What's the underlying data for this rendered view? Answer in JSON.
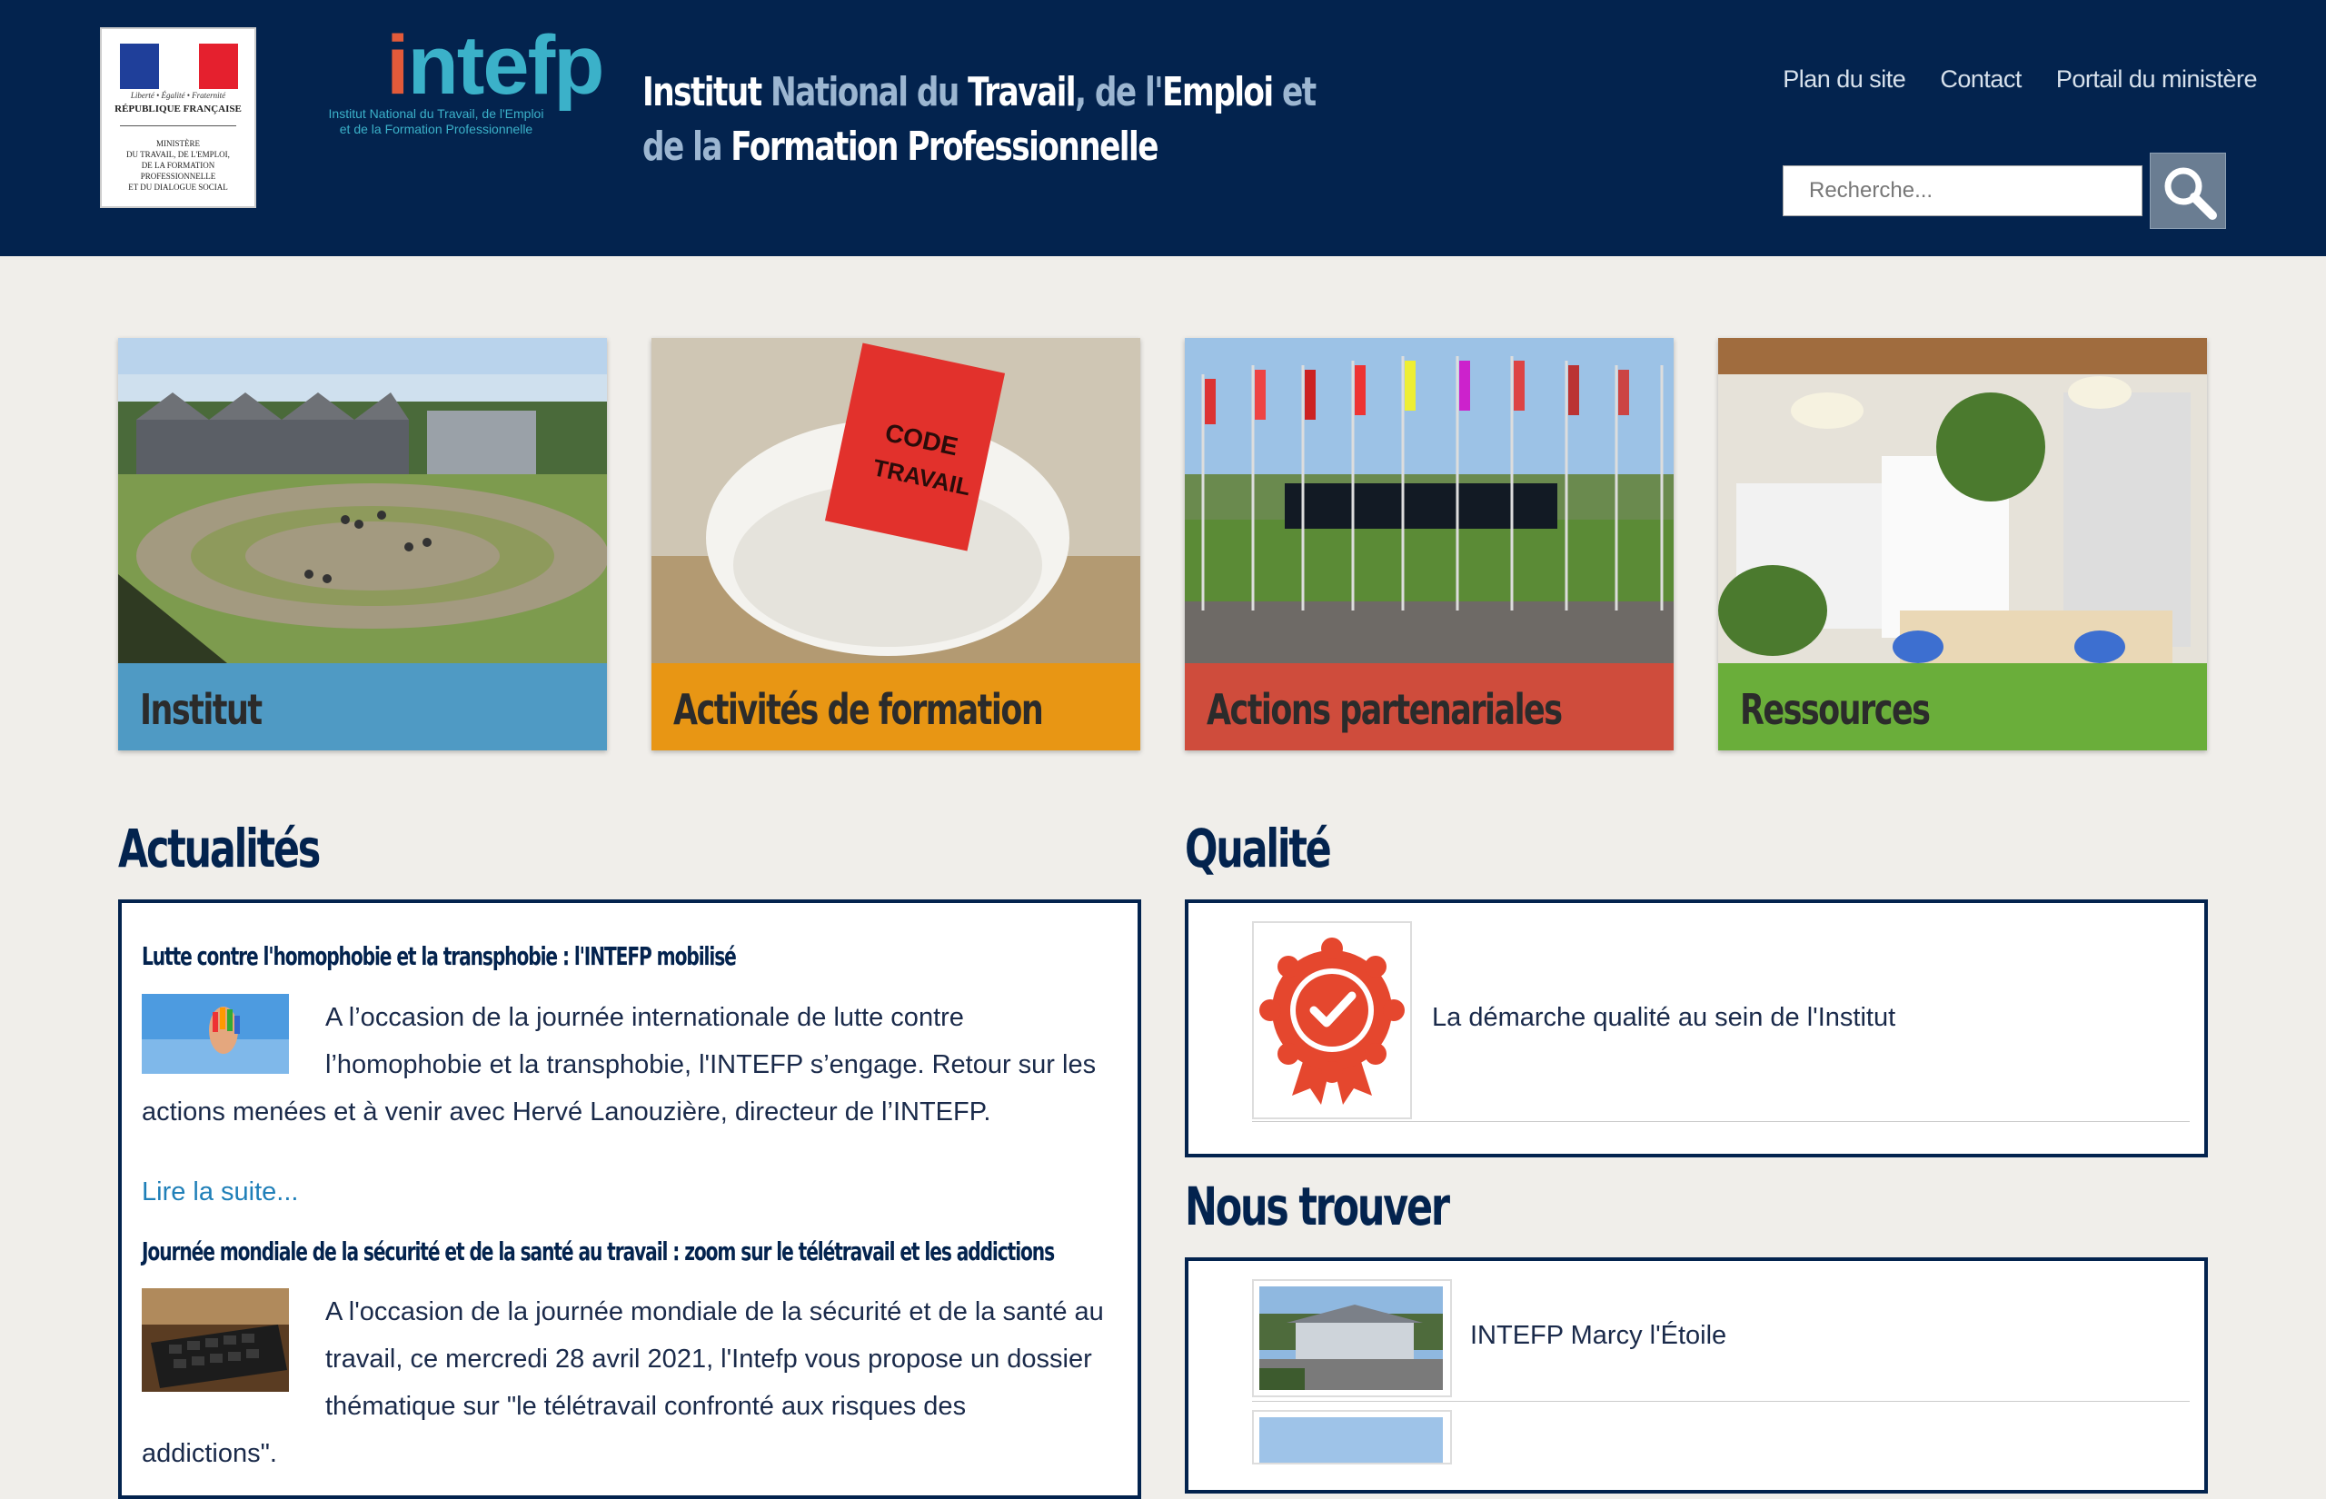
{
  "header": {
    "logo_gov": {
      "devise": "Liberté • Égalité • Fraternité",
      "republique": "RÉPUBLIQUE FRANÇAISE",
      "ministere": "MINISTÈRE\nDU TRAVAIL, DE L'EMPLOI,\nDE LA FORMATION\nPROFESSIONNELLE\nET DU DIALOGUE SOCIAL"
    },
    "logo_intefp": {
      "word_i": "i",
      "word_rest": "ntefp",
      "subtitle": "Institut National du Travail, de l'Emploi\net de la Formation Professionnelle"
    },
    "title_parts": [
      "Institut",
      " National du ",
      "Travail",
      ", de l'",
      "Emploi",
      " et de la ",
      "Formation",
      " Professionnelle"
    ],
    "top_links": [
      "Plan du site",
      "Contact",
      "Portail du ministère"
    ],
    "search_placeholder": "Recherche..."
  },
  "tiles": [
    {
      "label": "Institut",
      "color": "#4f9ac4"
    },
    {
      "label": "Activités de formation",
      "color": "#e89614"
    },
    {
      "label": "Actions partenariales",
      "color": "#cf4c3c"
    },
    {
      "label": "Ressources",
      "color": "#6aae3a"
    }
  ],
  "news": {
    "title": "Actualités",
    "items": [
      {
        "heading": "Lutte contre l'homophobie et la transphobie : l'INTEFP mobilisé",
        "body": "A l’occasion de la journée internationale de lutte contre l’homophobie et la transphobie, l'INTEFP s’engage. Retour sur les actions menées et à venir avec Hervé Lanouzière, directeur de l’INTEFP.",
        "more": "Lire la suite..."
      },
      {
        "heading": "Journée mondiale de la sécurité et de la santé au travail : zoom sur le télétravail et les addictions",
        "body": "A l'occasion de la journée mondiale de la sécurité et de la santé au travail, ce mercredi 28 avril 2021, l'Intefp vous propose un dossier thématique sur \"le télétravail confronté aux risques des addictions\"."
      }
    ]
  },
  "quality": {
    "title": "Qualité",
    "item_text": "La démarche qualité au sein de l'Institut"
  },
  "location": {
    "title": "Nous trouver",
    "item_text": "INTEFP Marcy l'Étoile"
  }
}
